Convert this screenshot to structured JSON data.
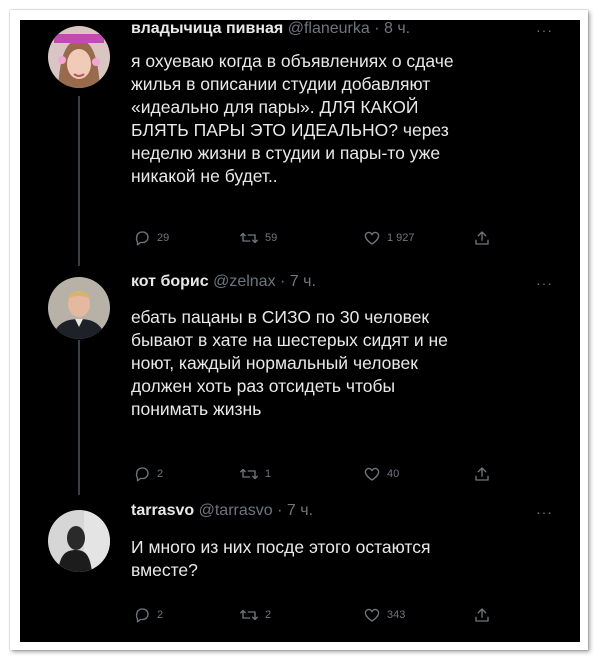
{
  "tweets": [
    {
      "name": "владычица пивная",
      "handle": "@flaneurka",
      "time": "· 8 ч.",
      "more": "···",
      "text": "я охуеваю когда в объявлениях о сдаче\nжилья в описании студии добавляют\n«идеально для пары». ДЛЯ КАКОЙ\nБЛЯТЬ ПАРЫ ЭТО ИДЕАЛЬНО? через\nнеделю жизни в студии и пары-то уже\nникакой не будет..",
      "replies": "29",
      "retweets": "59",
      "likes": "1 927"
    },
    {
      "name": "кот борис",
      "handle": "@zelnax",
      "time": "· 7 ч.",
      "more": "···",
      "text": "ебать пацаны в СИЗО по 30 человек\nбывают в хате на шестерых сидят и не\nноют, каждый нормальный человек\nдолжен хоть раз отсидеть чтобы\nпонимать жизнь",
      "replies": "2",
      "retweets": "1",
      "likes": "40"
    },
    {
      "name": "tarrasvo",
      "handle": "@tarrasvo",
      "time": "· 7 ч.",
      "more": "···",
      "text": "И много из них посде этого остаются\nвместе?",
      "replies": "2",
      "retweets": "2",
      "likes": "343"
    }
  ],
  "colors": {
    "background": "#000000",
    "text": "#e9e9e9",
    "muted": "#6e767d",
    "thread_line": "#3a3f44"
  },
  "icons": [
    "reply-icon",
    "retweet-icon",
    "like-icon",
    "share-icon"
  ]
}
